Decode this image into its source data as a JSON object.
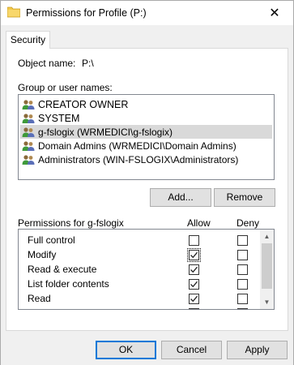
{
  "window": {
    "title": "Permissions for Profile (P:)",
    "close_glyph": "✕"
  },
  "tabs": [
    {
      "label": "Security"
    }
  ],
  "object": {
    "label": "Object name:",
    "value": "P:\\"
  },
  "groups": {
    "label": "Group or user names:",
    "items": [
      {
        "name": "CREATOR OWNER",
        "selected": false
      },
      {
        "name": "SYSTEM",
        "selected": false
      },
      {
        "name": "g-fslogix (WRMEDICI\\g-fslogix)",
        "selected": true
      },
      {
        "name": "Domain Admins (WRMEDICI\\Domain Admins)",
        "selected": false
      },
      {
        "name": "Administrators (WIN-FSLOGIX\\Administrators)",
        "selected": false
      }
    ]
  },
  "buttons": {
    "add": "Add...",
    "remove": "Remove",
    "ok": "OK",
    "cancel": "Cancel",
    "apply": "Apply"
  },
  "permissions": {
    "label": "Permissions for g-fslogix",
    "allow_header": "Allow",
    "deny_header": "Deny",
    "rows": [
      {
        "name": "Full control",
        "allow": false,
        "deny": false
      },
      {
        "name": "Modify",
        "allow": true,
        "deny": false
      },
      {
        "name": "Read & execute",
        "allow": true,
        "deny": false
      },
      {
        "name": "List folder contents",
        "allow": true,
        "deny": false
      },
      {
        "name": "Read",
        "allow": true,
        "deny": false
      },
      {
        "name": "",
        "allow": true,
        "deny": false
      }
    ]
  },
  "colors": {
    "selection": "#d9d9d9",
    "default_button": "#0078d7",
    "folder": "#f3c94b"
  },
  "icons": {
    "folder": "folder-icon",
    "user": "users-group-icon",
    "close": "close-icon"
  }
}
